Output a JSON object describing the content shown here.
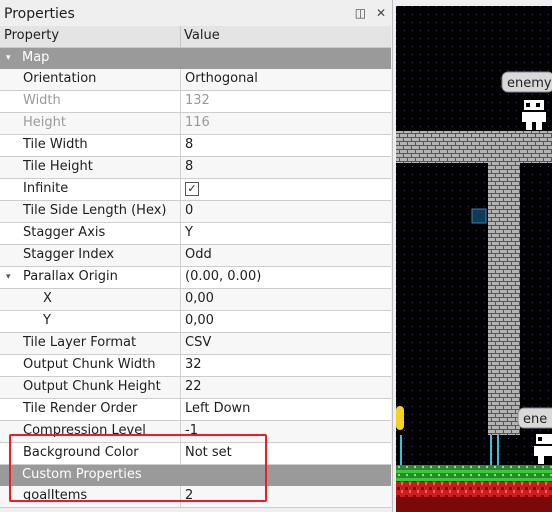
{
  "panel": {
    "title": "Properties",
    "buttons": {
      "float": "◫",
      "close": "✕"
    }
  },
  "table": {
    "columns": {
      "property": "Property",
      "value": "Value"
    },
    "rows": [
      {
        "type": "group",
        "name": "Map",
        "expanded": true
      },
      {
        "name": "Orientation",
        "value": "Orthogonal"
      },
      {
        "name": "Width",
        "value": "132",
        "disabled": true
      },
      {
        "name": "Height",
        "value": "116",
        "disabled": true
      },
      {
        "name": "Tile Width",
        "value": "8"
      },
      {
        "name": "Tile Height",
        "value": "8"
      },
      {
        "name": "Infinite",
        "checked": true
      },
      {
        "name": "Tile Side Length (Hex)",
        "value": "0"
      },
      {
        "name": "Stagger Axis",
        "value": "Y"
      },
      {
        "name": "Stagger Index",
        "value": "Odd"
      },
      {
        "name": "Parallax Origin",
        "value": "(0.00, 0.00)",
        "expanded": true
      },
      {
        "name": "X",
        "value": "0,00",
        "child": true
      },
      {
        "name": "Y",
        "value": "0,00",
        "child": true
      },
      {
        "name": "Tile Layer Format",
        "value": "CSV"
      },
      {
        "name": "Output Chunk Width",
        "value": "32"
      },
      {
        "name": "Output Chunk Height",
        "value": "22"
      },
      {
        "name": "Tile Render Order",
        "value": "Left Down"
      },
      {
        "name": "Compression Level",
        "value": "-1"
      },
      {
        "name": "Background Color",
        "value": "Not set"
      },
      {
        "type": "group",
        "name": "Custom Properties"
      },
      {
        "name": "goalItems",
        "value": "2"
      }
    ]
  },
  "map_view": {
    "labels": [
      "enemy",
      "ene"
    ]
  },
  "colors": {
    "group_bg": "#9a9a9a",
    "highlight": "#ee1c24",
    "map_bg": "#000000",
    "brick": "#b4b4b4",
    "grass": "#3cc83c",
    "lava": "#c81e1e"
  }
}
